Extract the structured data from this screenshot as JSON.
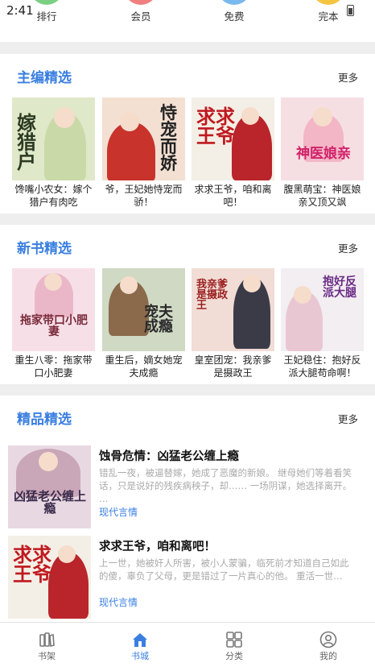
{
  "status_bar": {
    "time": "2:41"
  },
  "quick_nav": [
    {
      "label": "排行",
      "color": "#7bcf84"
    },
    {
      "label": "会员",
      "color": "#f07f7f"
    },
    {
      "label": "免费",
      "color": "#7ab8f0"
    },
    {
      "label": "完本",
      "color": "#f5c542"
    }
  ],
  "sections": {
    "editor": {
      "title": "主编精选",
      "more": "更多",
      "books": [
        {
          "name": "馋嘴小农女：嫁个猎户有肉吃",
          "cover_text": "嫁猎户",
          "cover_color": "#dfe8c9"
        },
        {
          "name": "爷，王妃她恃宠而骄！",
          "cover_text": "恃宠而娇",
          "cover_color": "#f3e0d2"
        },
        {
          "name": "求求王爷，咱和离吧！",
          "cover_text": "求求王爷",
          "cover_color": "#f4efe6"
        },
        {
          "name": "腹黑萌宝：神医娘亲又顶又飒",
          "cover_text": "神医娘亲",
          "cover_color": "#f6dfe3"
        }
      ]
    },
    "new": {
      "title": "新书精选",
      "more": "更多",
      "books": [
        {
          "name": "重生八零：拖家带口小肥妻",
          "cover_text": "拖家带口小肥妻",
          "cover_color": "#f7dfe8"
        },
        {
          "name": "重生后，嫡女她宠夫成瘾",
          "cover_text": "宠夫成瘾",
          "cover_color": "#cfd9c4"
        },
        {
          "name": "皇室团宠：我亲爹是摄政王",
          "cover_text": "我亲爹是摄政王",
          "cover_color": "#f1ddd6"
        },
        {
          "name": "王妃稳住：抱好反派大腿苟命啊！",
          "cover_text": "抱好反派大腿",
          "cover_color": "#f2eef2"
        }
      ]
    },
    "featured": {
      "title": "精品精选",
      "more": "更多",
      "items": [
        {
          "title": "蚀骨危情：凶猛老公缠上瘾",
          "desc": "错乱一夜，被逼替嫁，她成了恶魔的新娘。 继母她们等着看笑话，只是说好的残疾病秧子，却…… 一场阴谋，她选择离开。 …",
          "tag": "现代言情",
          "cover_text": "凶猛老公缠上瘾",
          "cover_color": "#e8d8e2"
        },
        {
          "title": "求求王爷，咱和离吧！",
          "desc": "上一世，她被奸人所害，被小人蒙骗，临死前才知道自己如此的傻，辜负了父母，更是错过了一片真心的他。 重活一世…",
          "tag": "现代言情",
          "cover_text": "求求王爷",
          "cover_color": "#f4efe6"
        }
      ]
    }
  },
  "bottom_nav": [
    {
      "label": "书架",
      "icon": "bookshelf-icon"
    },
    {
      "label": "书城",
      "icon": "home-icon",
      "active": true
    },
    {
      "label": "分类",
      "icon": "grid-icon"
    },
    {
      "label": "我的",
      "icon": "user-icon"
    }
  ],
  "accent_color": "#3a7fe0"
}
